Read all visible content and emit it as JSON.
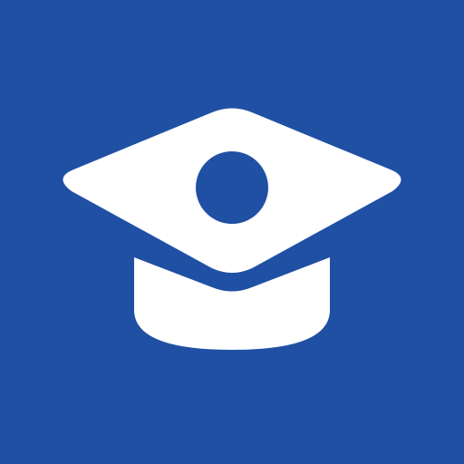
{
  "icon": {
    "name": "graduation-cap-icon",
    "background_color": "#2050A4",
    "foreground_color": "#FFFFFF"
  }
}
